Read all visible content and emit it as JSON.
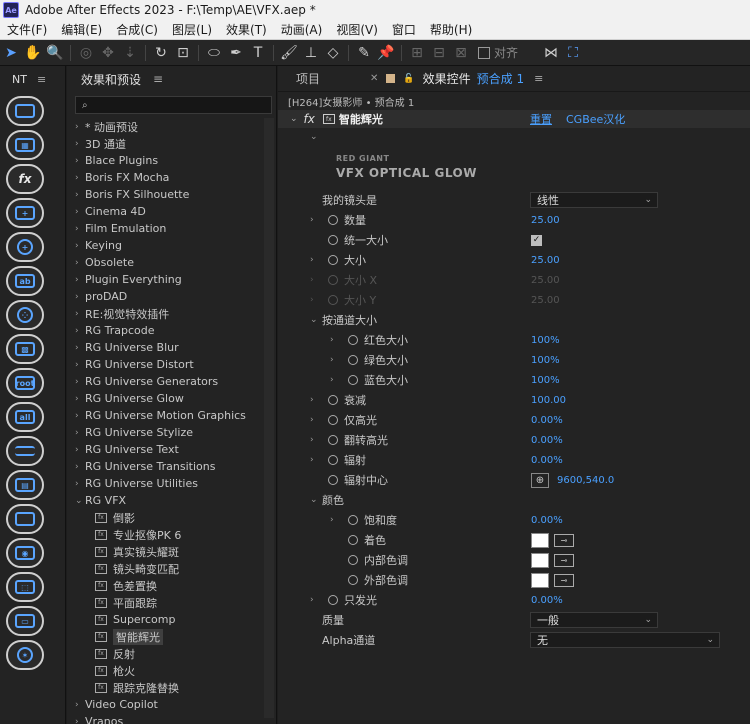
{
  "window": {
    "title": "Adobe After Effects 2023 - F:\\Temp\\AE\\VFX.aep *",
    "logo": "Ae"
  },
  "menu": [
    "文件(F)",
    "编辑(E)",
    "合成(C)",
    "图层(L)",
    "效果(T)",
    "动画(A)",
    "视图(V)",
    "窗口",
    "帮助(H)"
  ],
  "toolbar": {
    "snap_label": "对齐"
  },
  "rail": {
    "header": "NT",
    "buttons": [
      "car-icon",
      "grid-icon",
      "fx-styles-icon",
      "image-add-icon",
      "target-icon",
      "ab-icon",
      "dots-icon",
      "mesh-icon",
      "root-folder-icon",
      "all-folder-icon",
      "list-icon",
      "layout-icon",
      "screen-icon",
      "camera-icon",
      "crop-icon",
      "monitor-icon",
      "star-icon"
    ],
    "labels": {
      "fx": "fx",
      "root": "root",
      "all": "all",
      "ab": "ab"
    }
  },
  "effects_panel": {
    "title": "效果和预设",
    "search_placeholder": "",
    "items": [
      {
        "label": "* 动画预设",
        "expanded": false
      },
      {
        "label": "3D 通道",
        "expanded": false
      },
      {
        "label": "Blace Plugins",
        "expanded": false
      },
      {
        "label": "Boris FX Mocha",
        "expanded": false
      },
      {
        "label": "Boris FX Silhouette",
        "expanded": false
      },
      {
        "label": "Cinema 4D",
        "expanded": false
      },
      {
        "label": "Film Emulation",
        "expanded": false
      },
      {
        "label": "Keying",
        "expanded": false
      },
      {
        "label": "Obsolete",
        "expanded": false
      },
      {
        "label": "Plugin Everything",
        "expanded": false
      },
      {
        "label": "proDAD",
        "expanded": false
      },
      {
        "label": "RE:视觉特效插件",
        "expanded": false
      },
      {
        "label": "RG Trapcode",
        "expanded": false
      },
      {
        "label": "RG Universe Blur",
        "expanded": false
      },
      {
        "label": "RG Universe Distort",
        "expanded": false
      },
      {
        "label": "RG Universe Generators",
        "expanded": false
      },
      {
        "label": "RG Universe Glow",
        "expanded": false
      },
      {
        "label": "RG Universe Motion Graphics",
        "expanded": false
      },
      {
        "label": "RG Universe Stylize",
        "expanded": false
      },
      {
        "label": "RG Universe Text",
        "expanded": false
      },
      {
        "label": "RG Universe Transitions",
        "expanded": false
      },
      {
        "label": "RG Universe Utilities",
        "expanded": false
      },
      {
        "label": "RG VFX",
        "expanded": true
      }
    ],
    "vfx_children": [
      "倒影",
      "专业抠像PK 6",
      "真实镜头耀斑",
      "镜头畸变匹配",
      "色差置换",
      "平面跟踪",
      "Supercomp",
      "智能辉光",
      "反射",
      "枪火",
      "跟踪克隆替换"
    ],
    "selected_child": "智能辉光",
    "tail_items": [
      "Video Copilot",
      "Vranos"
    ]
  },
  "effect_controls": {
    "tab_project": "项目",
    "tab_title": "效果控件",
    "tab_comp": "预合成 1",
    "source": "[H264]女摄影师 • 预合成 1",
    "fx_symbol": "fx",
    "effect_name": "智能辉光",
    "reset": "重置",
    "about": "CGBee汉化",
    "logo_line1": "RED GIANT",
    "logo_line2": "VFX OPTICAL GLOW",
    "lens_label": "我的镜头是",
    "lens_value": "线性",
    "count_label": "数量",
    "count_value": "25.00",
    "uniform_label": "统一大小",
    "size_label": "大小",
    "size_value": "25.00",
    "size_x_label": "大小 X",
    "size_x_value": "25.00",
    "size_y_label": "大小 Y",
    "size_y_value": "25.00",
    "per_channel_label": "按通道大小",
    "red_label": "红色大小",
    "red_value": "100%",
    "green_label": "绿色大小",
    "green_value": "100%",
    "blue_label": "蓝色大小",
    "blue_value": "100%",
    "falloff_label": "衰减",
    "falloff_value": "100.00",
    "highlights_label": "仅高光",
    "highlights_value": "0.00%",
    "flip_label": "翻转高光",
    "flip_value": "0.00%",
    "radial_label": "辐射",
    "radial_value": "0.00%",
    "radial_center_label": "辐射中心",
    "radial_center_value": "9600,540.0",
    "color_label": "颜色",
    "saturation_label": "饱和度",
    "saturation_value": "0.00%",
    "tint_label": "着色",
    "inner_label": "内部色调",
    "outer_label": "外部色调",
    "glow_only_label": "只发光",
    "glow_only_value": "0.00%",
    "quality_label": "质量",
    "quality_value": "一般",
    "alpha_label": "Alpha通道",
    "alpha_value": "无",
    "swatch_color": "#ffffff",
    "accent_color": "#4aa0ff"
  }
}
